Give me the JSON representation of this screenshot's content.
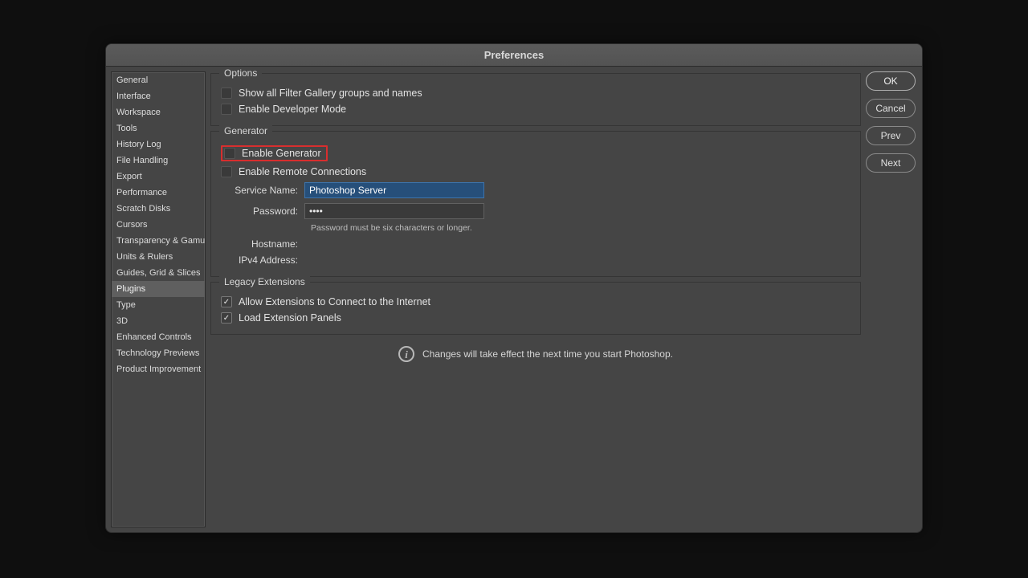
{
  "window": {
    "title": "Preferences"
  },
  "sidebar": {
    "items": [
      "General",
      "Interface",
      "Workspace",
      "Tools",
      "History Log",
      "File Handling",
      "Export",
      "Performance",
      "Scratch Disks",
      "Cursors",
      "Transparency & Gamut",
      "Units & Rulers",
      "Guides, Grid & Slices",
      "Plugins",
      "Type",
      "3D",
      "Enhanced Controls",
      "Technology Previews",
      "Product Improvement"
    ],
    "selected_index": 13
  },
  "buttons": {
    "ok": "OK",
    "cancel": "Cancel",
    "prev": "Prev",
    "next": "Next"
  },
  "options_group": {
    "legend": "Options",
    "show_filter_gallery": {
      "label": "Show all Filter Gallery groups and names",
      "checked": false
    },
    "enable_dev_mode": {
      "label": "Enable Developer Mode",
      "checked": false
    }
  },
  "generator_group": {
    "legend": "Generator",
    "enable_generator": {
      "label": "Enable Generator",
      "checked": false
    },
    "enable_remote": {
      "label": "Enable Remote Connections",
      "checked": false
    },
    "service_name_label": "Service Name:",
    "service_name_value": "Photoshop Server",
    "password_label": "Password:",
    "password_value": "••••",
    "password_hint": "Password must be six characters or longer.",
    "hostname_label": "Hostname:",
    "hostname_value": "",
    "ipv4_label": "IPv4 Address:",
    "ipv4_value": ""
  },
  "legacy_group": {
    "legend": "Legacy Extensions",
    "allow_internet": {
      "label": "Allow Extensions to Connect to the Internet",
      "checked": true
    },
    "load_panels": {
      "label": "Load Extension Panels",
      "checked": true
    }
  },
  "restart_note": "Changes will take effect the next time you start Photoshop."
}
